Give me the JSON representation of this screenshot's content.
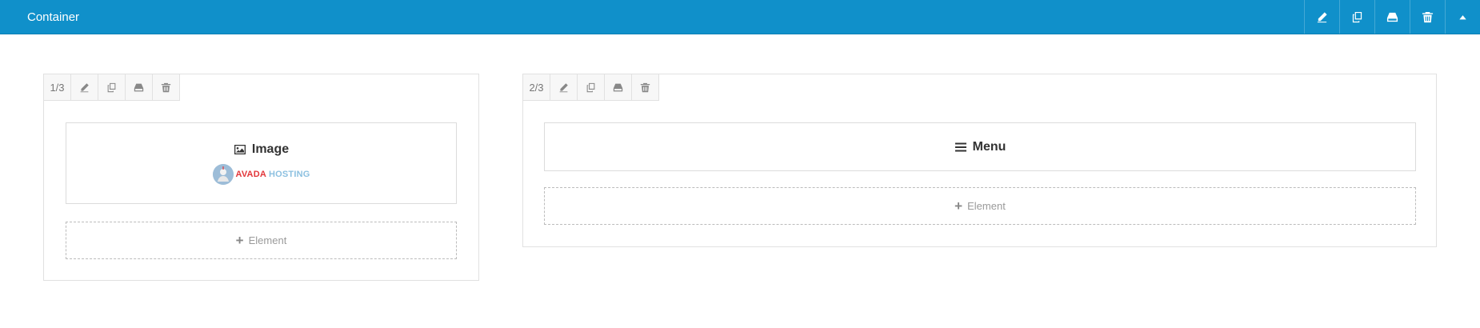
{
  "header": {
    "title": "Container",
    "actions": [
      {
        "name": "edit",
        "icon": "pencil-icon"
      },
      {
        "name": "clone",
        "icon": "clone-icon"
      },
      {
        "name": "save",
        "icon": "drive-icon"
      },
      {
        "name": "delete",
        "icon": "trash-icon"
      },
      {
        "name": "collapse",
        "icon": "caret-up-icon"
      }
    ],
    "color": "#1090ca"
  },
  "columns": [
    {
      "size": "1/3",
      "element": {
        "title": "Image",
        "icon": "image-icon",
        "preview": {
          "brand_part1": "AVADA",
          "brand_part2": "HOSTING"
        }
      },
      "add_label": "Element"
    },
    {
      "size": "2/3",
      "element": {
        "title": "Menu",
        "icon": "menu-icon"
      },
      "add_label": "Element"
    }
  ]
}
